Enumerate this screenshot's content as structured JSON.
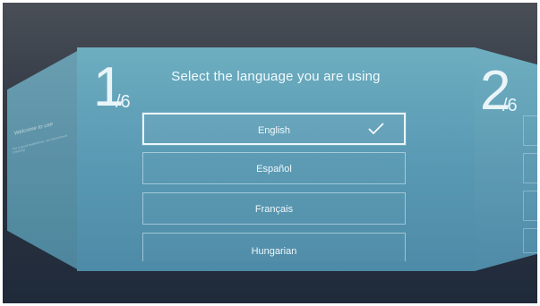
{
  "wizard": {
    "step_current": "1",
    "step_total_label": "/6",
    "next_step": "2",
    "next_total_label": "/6",
    "title": "Select the language you are using"
  },
  "languages": [
    {
      "label": "English",
      "selected": true
    },
    {
      "label": "Español",
      "selected": false
    },
    {
      "label": "Français",
      "selected": false
    },
    {
      "label": "Hungarian",
      "selected": false
    }
  ],
  "left_panel": {
    "welcome_text": "Welcome to use",
    "sub_text": "For a good experience, we recommend checking"
  },
  "icons": {
    "selected_check": "checkmark-icon"
  },
  "colors": {
    "panel": "#5d9db6",
    "text": "#eef8fb",
    "background": "#2e3542"
  }
}
